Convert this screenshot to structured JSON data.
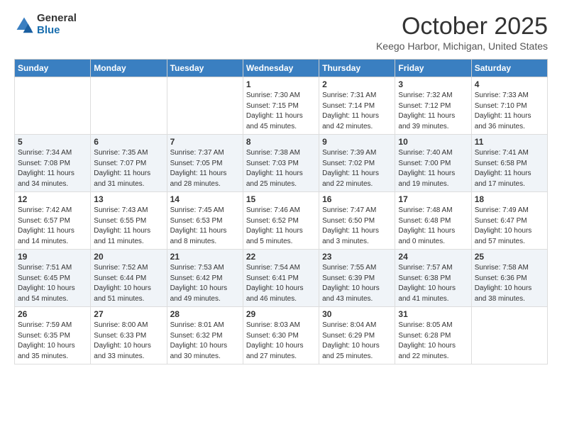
{
  "logo": {
    "general": "General",
    "blue": "Blue"
  },
  "header": {
    "month": "October 2025",
    "location": "Keego Harbor, Michigan, United States"
  },
  "weekdays": [
    "Sunday",
    "Monday",
    "Tuesday",
    "Wednesday",
    "Thursday",
    "Friday",
    "Saturday"
  ],
  "weeks": [
    [
      {
        "day": "",
        "sunrise": "",
        "sunset": "",
        "daylight": ""
      },
      {
        "day": "",
        "sunrise": "",
        "sunset": "",
        "daylight": ""
      },
      {
        "day": "",
        "sunrise": "",
        "sunset": "",
        "daylight": ""
      },
      {
        "day": "1",
        "sunrise": "Sunrise: 7:30 AM",
        "sunset": "Sunset: 7:15 PM",
        "daylight": "Daylight: 11 hours and 45 minutes."
      },
      {
        "day": "2",
        "sunrise": "Sunrise: 7:31 AM",
        "sunset": "Sunset: 7:14 PM",
        "daylight": "Daylight: 11 hours and 42 minutes."
      },
      {
        "day": "3",
        "sunrise": "Sunrise: 7:32 AM",
        "sunset": "Sunset: 7:12 PM",
        "daylight": "Daylight: 11 hours and 39 minutes."
      },
      {
        "day": "4",
        "sunrise": "Sunrise: 7:33 AM",
        "sunset": "Sunset: 7:10 PM",
        "daylight": "Daylight: 11 hours and 36 minutes."
      }
    ],
    [
      {
        "day": "5",
        "sunrise": "Sunrise: 7:34 AM",
        "sunset": "Sunset: 7:08 PM",
        "daylight": "Daylight: 11 hours and 34 minutes."
      },
      {
        "day": "6",
        "sunrise": "Sunrise: 7:35 AM",
        "sunset": "Sunset: 7:07 PM",
        "daylight": "Daylight: 11 hours and 31 minutes."
      },
      {
        "day": "7",
        "sunrise": "Sunrise: 7:37 AM",
        "sunset": "Sunset: 7:05 PM",
        "daylight": "Daylight: 11 hours and 28 minutes."
      },
      {
        "day": "8",
        "sunrise": "Sunrise: 7:38 AM",
        "sunset": "Sunset: 7:03 PM",
        "daylight": "Daylight: 11 hours and 25 minutes."
      },
      {
        "day": "9",
        "sunrise": "Sunrise: 7:39 AM",
        "sunset": "Sunset: 7:02 PM",
        "daylight": "Daylight: 11 hours and 22 minutes."
      },
      {
        "day": "10",
        "sunrise": "Sunrise: 7:40 AM",
        "sunset": "Sunset: 7:00 PM",
        "daylight": "Daylight: 11 hours and 19 minutes."
      },
      {
        "day": "11",
        "sunrise": "Sunrise: 7:41 AM",
        "sunset": "Sunset: 6:58 PM",
        "daylight": "Daylight: 11 hours and 17 minutes."
      }
    ],
    [
      {
        "day": "12",
        "sunrise": "Sunrise: 7:42 AM",
        "sunset": "Sunset: 6:57 PM",
        "daylight": "Daylight: 11 hours and 14 minutes."
      },
      {
        "day": "13",
        "sunrise": "Sunrise: 7:43 AM",
        "sunset": "Sunset: 6:55 PM",
        "daylight": "Daylight: 11 hours and 11 minutes."
      },
      {
        "day": "14",
        "sunrise": "Sunrise: 7:45 AM",
        "sunset": "Sunset: 6:53 PM",
        "daylight": "Daylight: 11 hours and 8 minutes."
      },
      {
        "day": "15",
        "sunrise": "Sunrise: 7:46 AM",
        "sunset": "Sunset: 6:52 PM",
        "daylight": "Daylight: 11 hours and 5 minutes."
      },
      {
        "day": "16",
        "sunrise": "Sunrise: 7:47 AM",
        "sunset": "Sunset: 6:50 PM",
        "daylight": "Daylight: 11 hours and 3 minutes."
      },
      {
        "day": "17",
        "sunrise": "Sunrise: 7:48 AM",
        "sunset": "Sunset: 6:48 PM",
        "daylight": "Daylight: 11 hours and 0 minutes."
      },
      {
        "day": "18",
        "sunrise": "Sunrise: 7:49 AM",
        "sunset": "Sunset: 6:47 PM",
        "daylight": "Daylight: 10 hours and 57 minutes."
      }
    ],
    [
      {
        "day": "19",
        "sunrise": "Sunrise: 7:51 AM",
        "sunset": "Sunset: 6:45 PM",
        "daylight": "Daylight: 10 hours and 54 minutes."
      },
      {
        "day": "20",
        "sunrise": "Sunrise: 7:52 AM",
        "sunset": "Sunset: 6:44 PM",
        "daylight": "Daylight: 10 hours and 51 minutes."
      },
      {
        "day": "21",
        "sunrise": "Sunrise: 7:53 AM",
        "sunset": "Sunset: 6:42 PM",
        "daylight": "Daylight: 10 hours and 49 minutes."
      },
      {
        "day": "22",
        "sunrise": "Sunrise: 7:54 AM",
        "sunset": "Sunset: 6:41 PM",
        "daylight": "Daylight: 10 hours and 46 minutes."
      },
      {
        "day": "23",
        "sunrise": "Sunrise: 7:55 AM",
        "sunset": "Sunset: 6:39 PM",
        "daylight": "Daylight: 10 hours and 43 minutes."
      },
      {
        "day": "24",
        "sunrise": "Sunrise: 7:57 AM",
        "sunset": "Sunset: 6:38 PM",
        "daylight": "Daylight: 10 hours and 41 minutes."
      },
      {
        "day": "25",
        "sunrise": "Sunrise: 7:58 AM",
        "sunset": "Sunset: 6:36 PM",
        "daylight": "Daylight: 10 hours and 38 minutes."
      }
    ],
    [
      {
        "day": "26",
        "sunrise": "Sunrise: 7:59 AM",
        "sunset": "Sunset: 6:35 PM",
        "daylight": "Daylight: 10 hours and 35 minutes."
      },
      {
        "day": "27",
        "sunrise": "Sunrise: 8:00 AM",
        "sunset": "Sunset: 6:33 PM",
        "daylight": "Daylight: 10 hours and 33 minutes."
      },
      {
        "day": "28",
        "sunrise": "Sunrise: 8:01 AM",
        "sunset": "Sunset: 6:32 PM",
        "daylight": "Daylight: 10 hours and 30 minutes."
      },
      {
        "day": "29",
        "sunrise": "Sunrise: 8:03 AM",
        "sunset": "Sunset: 6:30 PM",
        "daylight": "Daylight: 10 hours and 27 minutes."
      },
      {
        "day": "30",
        "sunrise": "Sunrise: 8:04 AM",
        "sunset": "Sunset: 6:29 PM",
        "daylight": "Daylight: 10 hours and 25 minutes."
      },
      {
        "day": "31",
        "sunrise": "Sunrise: 8:05 AM",
        "sunset": "Sunset: 6:28 PM",
        "daylight": "Daylight: 10 hours and 22 minutes."
      },
      {
        "day": "",
        "sunrise": "",
        "sunset": "",
        "daylight": ""
      }
    ]
  ]
}
